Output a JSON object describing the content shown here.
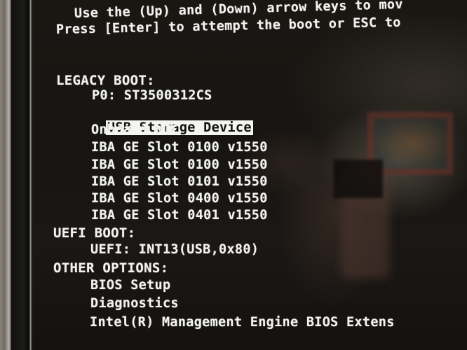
{
  "instructions": {
    "line1": "Use the (Up) and (Down) arrow keys to mov",
    "line2": "Press [Enter] to attempt the boot or ESC to"
  },
  "legacy_boot": {
    "header": "LEGACY BOOT:",
    "items": [
      {
        "label": "P0: ST3500312CS",
        "selected": false
      },
      {
        "label": "USB Storage Device",
        "selected": true
      },
      {
        "label": "Onboard NIC",
        "selected": false
      },
      {
        "label": "IBA GE Slot 0100 v1550",
        "selected": false
      },
      {
        "label": "IBA GE Slot 0100 v1550",
        "selected": false
      },
      {
        "label": "IBA GE Slot 0101 v1550",
        "selected": false
      },
      {
        "label": "IBA GE Slot 0400 v1550",
        "selected": false
      },
      {
        "label": "IBA GE Slot 0401 v1550",
        "selected": false
      }
    ]
  },
  "uefi_boot": {
    "header": "UEFI BOOT:",
    "items": [
      {
        "label": "UEFI: INT13(USB,0x80)"
      }
    ]
  },
  "other_options": {
    "header": "OTHER OPTIONS:",
    "items": [
      {
        "label": "BIOS Setup"
      },
      {
        "label": "Diagnostics"
      },
      {
        "label": "Intel(R) Management Engine BIOS Extens"
      }
    ]
  },
  "colors": {
    "text": "#f2f2ee",
    "highlight_bg": "#f4f4f0",
    "highlight_text": "#111111",
    "screen_bg": "#171512"
  }
}
